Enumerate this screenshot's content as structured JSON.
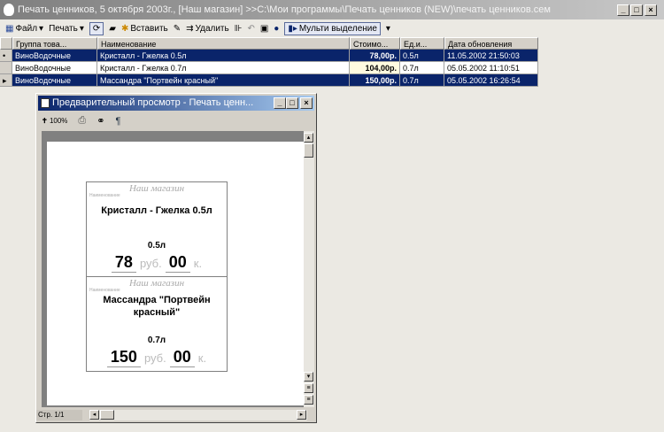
{
  "window": {
    "title": "Печать ценников, 5 октября 2003г., [Наш магазин] >>C:\\Мои программы\\Печать ценников (NEW)\\печать ценников.сем"
  },
  "toolbar": {
    "file": "Файл",
    "print": "Печать",
    "insert": "Вставить",
    "delete": "Удалить",
    "multi": "Мульти выделение"
  },
  "grid": {
    "headers": [
      "Группа това...",
      "Наименование",
      "Стоимо...",
      "Ед.и...",
      "Дата обновления"
    ],
    "rows": [
      {
        "group": "ВиноВодочные",
        "name": "Кристалл - Гжелка 0.5л",
        "price": "78,00р.",
        "unit": "0.5л",
        "date": "11.05.2002 21:50:03"
      },
      {
        "group": "ВиноВодочные",
        "name": "Кристалл - Гжелка 0.7л",
        "price": "104,00р.",
        "unit": "0.7л",
        "date": "05.05.2002 11:10:51"
      },
      {
        "group": "ВиноВодочные",
        "name": "Массандра \"Портвейн красный\"",
        "price": "150,00р.",
        "unit": "0.7л",
        "date": "05.05.2002 16:26:54"
      }
    ]
  },
  "preview": {
    "title": "Предварительный просмотр - Печать ценн...",
    "zoom": "100%",
    "status": "Стр. 1/1",
    "cards": [
      {
        "shop": "Наш магазин",
        "label": "Наименование",
        "name": "Кристалл - Гжелка 0.5л",
        "unit": "0.5л",
        "rub": "78",
        "rub_label": "руб.",
        "kop": "00",
        "kop_label": "к."
      },
      {
        "shop": "Наш магазин",
        "label": "Наименование",
        "name": "Массандра \"Портвейн красный\"",
        "unit": "0.7л",
        "rub": "150",
        "rub_label": "руб.",
        "kop": "00",
        "kop_label": "к."
      }
    ]
  }
}
